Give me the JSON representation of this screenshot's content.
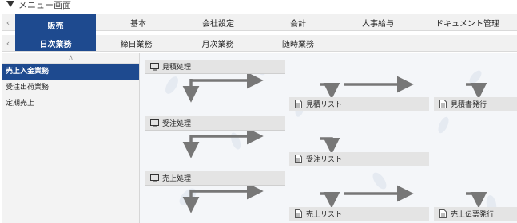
{
  "caption": "メニュー画面",
  "menu": {
    "main_tabs": [
      {
        "label": "販売",
        "active": true
      },
      {
        "label": "基本",
        "active": false
      },
      {
        "label": "会社設定",
        "active": false
      },
      {
        "label": "会計",
        "active": false
      },
      {
        "label": "人事給与",
        "active": false
      },
      {
        "label": "ドキュメント管理",
        "active": false
      }
    ],
    "sub_tabs": [
      {
        "label": "日次業務",
        "active": true
      },
      {
        "label": "締日業務",
        "active": false
      },
      {
        "label": "月次業務",
        "active": false
      },
      {
        "label": "随時業務",
        "active": false
      }
    ]
  },
  "sidebar": {
    "items": [
      {
        "label": "売上入金業務",
        "active": true
      },
      {
        "label": "受注出荷業務",
        "active": false
      },
      {
        "label": "定期売上",
        "active": false
      }
    ]
  },
  "flow": {
    "processes": [
      "見積処理",
      "受注処理",
      "売上処理"
    ],
    "lists": [
      "見積リスト",
      "見積書発行",
      "受注リスト",
      "売上リスト",
      "売上伝票発行"
    ]
  },
  "colors": {
    "accent": "#1e4a8f",
    "arrow": "#777777"
  },
  "icons": {
    "process": "monitor-icon",
    "document": "document-icon",
    "scroll_left": "chevron-left-icon",
    "scroll_up": "chevron-up-icon"
  }
}
